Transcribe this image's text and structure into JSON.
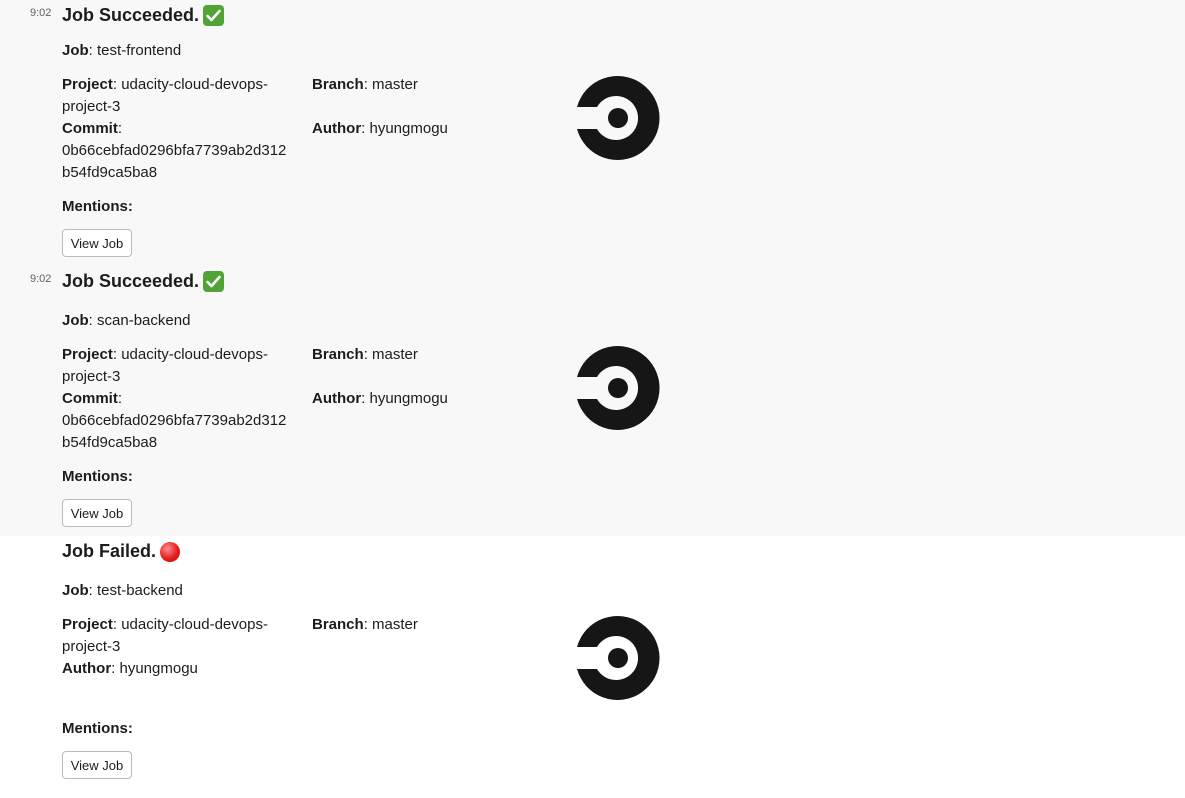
{
  "labels": {
    "job": "Job",
    "project": "Project",
    "branch": "Branch",
    "commit": "Commit",
    "author": "Author",
    "mentions": "Mentions:",
    "view_job": "View Job"
  },
  "messages": [
    {
      "time": "9:02",
      "title": "Job Succeeded.",
      "status_icon": "check-emoji",
      "job": "test-frontend",
      "project_line1": "udacity-cloud-devops-",
      "project_line2": "project-3",
      "branch": "master",
      "commit_line1": "0b66cebfad0296bfa7739ab2d312",
      "commit_line2": "b54fd9ca5ba8",
      "author": "hyungmogu"
    },
    {
      "time": "9:02",
      "title": "Job Succeeded.",
      "status_icon": "check-emoji",
      "job": "scan-backend",
      "project_line1": "udacity-cloud-devops-",
      "project_line2": "project-3",
      "branch": "master",
      "commit_line1": "0b66cebfad0296bfa7739ab2d312",
      "commit_line2": "b54fd9ca5ba8",
      "author": "hyungmogu"
    },
    {
      "title": "Job Failed.",
      "status_icon": "red-circle-emoji",
      "job": "test-backend",
      "project_line1": "udacity-cloud-devops-",
      "project_line2": "project-3",
      "branch": "master",
      "author": "hyungmogu"
    }
  ],
  "colors": {
    "highlight_bg": "#f8f8f8",
    "success": "#52a335",
    "failure": "#e21d1d",
    "logo": "#161616"
  }
}
